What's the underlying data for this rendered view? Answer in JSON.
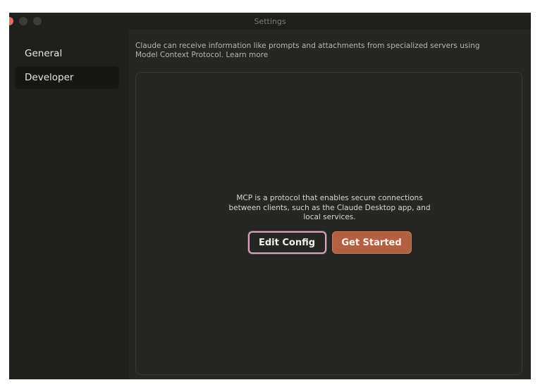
{
  "window": {
    "title": "Settings"
  },
  "sidebar": {
    "items": [
      {
        "label": "General",
        "selected": false
      },
      {
        "label": "Developer",
        "selected": true
      }
    ]
  },
  "main": {
    "intro_line1": "Claude can receive information like prompts and attachments from specialized servers using",
    "intro_line2": "Model Context Protocol.",
    "learn_more": "Learn more",
    "description_lines": [
      "MCP is a protocol that enables secure connections",
      "between clients, such as the Claude Desktop app, and",
      "local services."
    ],
    "edit_config_label": "Edit Config",
    "get_started_label": "Get Started"
  },
  "colors": {
    "background": "#262624",
    "sidebar": "#1f1f1e",
    "accent": "#b25f43",
    "focus_ring": "#d9a5bf"
  }
}
